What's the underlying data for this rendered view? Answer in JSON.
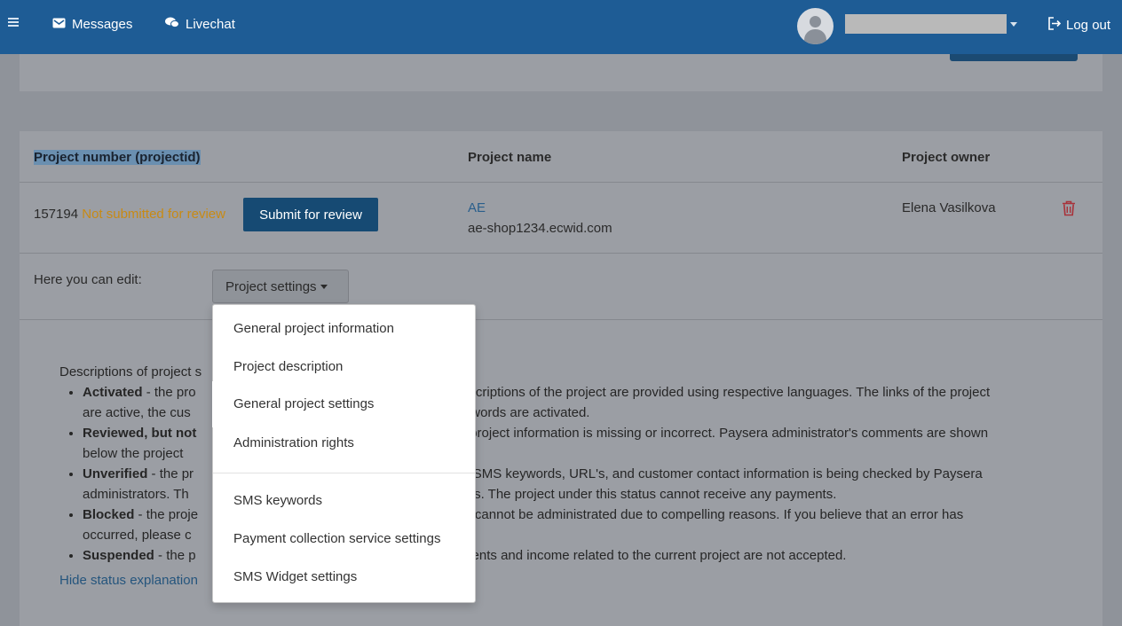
{
  "nav": {
    "messages_label": "Messages",
    "livechat_label": "Livechat",
    "logout_label": "Log out"
  },
  "table": {
    "headers": [
      "Project number (projectid)",
      "Project name",
      "Project owner"
    ],
    "row": {
      "project_id": "157194",
      "status": "Not submitted for review",
      "submit_label": "Submit for review",
      "project_name": "AE",
      "project_domain": "ae-shop1234.ecwid.com",
      "owner": "Elena Vasilkova"
    }
  },
  "edit": {
    "label": "Here you can edit:",
    "button_label": "Project settings"
  },
  "dropdown": {
    "items": [
      "General project information",
      "Project description",
      "General project settings",
      "Administration rights",
      "SMS keywords",
      "Payment collection service settings",
      "SMS Widget settings"
    ],
    "active_index": 2
  },
  "descriptions": {
    "intro": "Descriptions of project s",
    "items": [
      {
        "bold": "Activated",
        "a": " - the pro",
        "b": " descriptions of the project are provided using respective languages. The links of the project",
        "c": "are active, the cus",
        "d": " keywords are activated."
      },
      {
        "bold": "Reviewed, but not",
        "a": "",
        "b": "he project information is missing or incorrect. Paysera administrator's comments are shown",
        "c": "below the project ",
        "d": ""
      },
      {
        "bold": "Unverified",
        "a": " - the pr",
        "b": "n, SMS keywords, URL's, and customer contact information is being checked by Paysera",
        "c": "administrators. Th",
        "d": "ss days. The project under this status cannot receive any payments."
      },
      {
        "bold": "Blocked",
        "a": " - the proje",
        "b": "ct cannot be administrated due to compelling reasons. If you believe that an error has",
        "c": "occurred, please c",
        "d": ""
      },
      {
        "bold": "Suspended",
        "a": " - the p",
        "b": "yments and income related to the current project are not accepted.",
        "c": "",
        "d": ""
      }
    ],
    "hide_link": "Hide status explanation"
  }
}
